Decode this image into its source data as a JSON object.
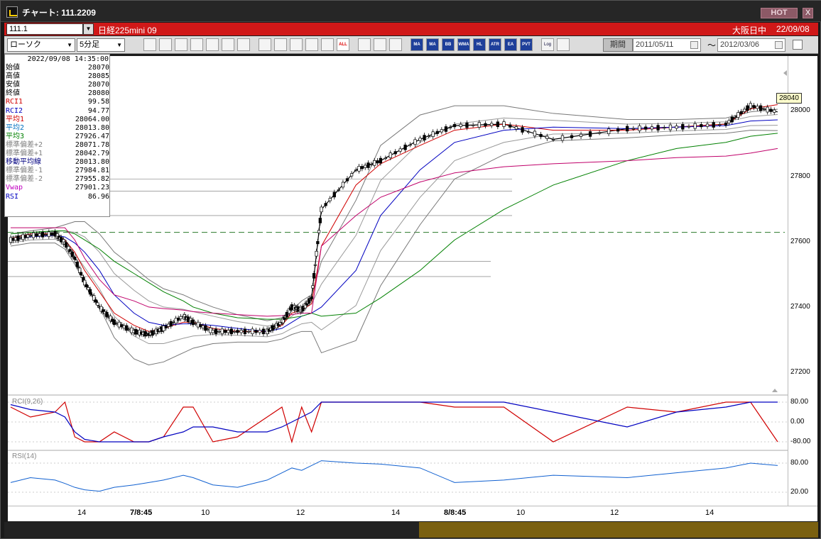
{
  "window": {
    "title": "チャート: 111.2209",
    "hot": "HOT",
    "close": "X"
  },
  "header": {
    "symbol": "111.1",
    "instrument": "日経225mini 09",
    "market": "大阪日中",
    "date": "22/09/08"
  },
  "toolbar": {
    "chart_type": "ローソク",
    "timeframe": "5分足",
    "buttons": [
      "zoom",
      "crosshair",
      "step-down",
      "zoom-chart",
      "icon",
      "icon",
      "icon",
      "pen",
      "cursor",
      "refresh",
      "candle-a",
      "candle-b",
      "ALL",
      "settings",
      "pencil",
      "color",
      "MA",
      "MA",
      "BB",
      "WMA",
      "HL",
      "ATR",
      "EA",
      "PVT",
      "Log",
      "export"
    ],
    "period_label": "期間",
    "date_from": "2011/05/11",
    "tilde": "～",
    "date_to": "2012/03/06"
  },
  "info_panel": {
    "datetime": "2022/09/08  14:35:00",
    "rows": [
      {
        "label": "始値",
        "value": "28070",
        "color": "#000000"
      },
      {
        "label": "高値",
        "value": "28085",
        "color": "#000000"
      },
      {
        "label": "安値",
        "value": "28070",
        "color": "#000000"
      },
      {
        "label": "終値",
        "value": "28080",
        "color": "#000000"
      },
      {
        "label": "RCI1",
        "value": "99.58",
        "color": "#d00000"
      },
      {
        "label": "RCI2",
        "value": "94.77",
        "color": "#0000c0"
      },
      {
        "label": "平均1",
        "value": "28064.00",
        "color": "#d00000"
      },
      {
        "label": "平均2",
        "value": "28013.80",
        "color": "#0070c0"
      },
      {
        "label": "平均3",
        "value": "27926.47",
        "color": "#008000"
      },
      {
        "label": "標準偏差+2",
        "value": "28071.78",
        "color": "#808080"
      },
      {
        "label": "標準偏差+1",
        "value": "28042.79",
        "color": "#808080"
      },
      {
        "label": "移動平均線",
        "value": "28013.80",
        "color": "#000080"
      },
      {
        "label": "標準偏差-1",
        "value": "27984.81",
        "color": "#808080"
      },
      {
        "label": "標準偏差-2",
        "value": "27955.82",
        "color": "#808080"
      },
      {
        "label": "Vwap",
        "value": "27901.23",
        "color": "#c000c0"
      },
      {
        "label": "RSI",
        "value": "86.96",
        "color": "#0000c0"
      }
    ]
  },
  "last_price": "28040",
  "subpanels": {
    "rci_label": "RCI(9,26)",
    "rsi_label": "RSI(14)"
  },
  "chart_data": {
    "type": "line",
    "title": "",
    "y_ticks_main": [
      "28000",
      "27800",
      "27600",
      "27400",
      "27200"
    ],
    "y_ticks_rci": [
      "80.00",
      "0.00",
      "-80.00"
    ],
    "y_ticks_rsi": [
      "80.00",
      "20.00"
    ],
    "x_ticks": [
      "14",
      "7/8:45",
      "10",
      "12",
      "14",
      "8/8:45",
      "10",
      "12",
      "14"
    ],
    "ylim": [
      27130,
      28200
    ],
    "x": [
      0,
      8,
      18,
      22,
      26,
      30,
      36,
      42,
      50,
      56,
      62,
      70,
      74,
      82,
      92,
      104,
      110,
      114,
      118,
      122,
      126,
      140,
      150,
      166,
      180,
      200,
      220,
      250,
      270,
      290,
      300,
      311
    ],
    "series": [
      {
        "name": "",
        "values": [
          27620,
          27635,
          27640,
          27610,
          27560,
          27480,
          27400,
          27350,
          27320,
          27310,
          27330,
          27370,
          27350,
          27320,
          27320,
          27320,
          27350,
          27400,
          27390,
          27430,
          27720,
          27850,
          27880,
          27950,
          27995,
          28000,
          27950,
          27985,
          27990,
          28000,
          28060,
          28040
        ],
        "color": "#000000"
      },
      {
        "name": "",
        "values": [
          27625,
          27640,
          27640,
          27620,
          27580,
          27520,
          27450,
          27380,
          27340,
          27320,
          27330,
          27350,
          27350,
          27330,
          27320,
          27320,
          27340,
          27380,
          27390,
          27410,
          27600,
          27800,
          27870,
          27930,
          27980,
          28000,
          27980,
          27980,
          27990,
          28000,
          28050,
          28064
        ],
        "color": "#d00000"
      },
      {
        "name": "",
        "values": [
          27620,
          27630,
          27635,
          27630,
          27610,
          27580,
          27520,
          27440,
          27380,
          27350,
          27340,
          27345,
          27345,
          27340,
          27330,
          27320,
          27330,
          27350,
          27370,
          27380,
          27400,
          27520,
          27700,
          27850,
          27940,
          27980,
          27990,
          27985,
          27990,
          27995,
          28010,
          28013.8
        ],
        "color": "#0000c0"
      },
      {
        "name": "",
        "values": [
          27640,
          27645,
          27650,
          27650,
          27640,
          27620,
          27590,
          27550,
          27510,
          27480,
          27450,
          27420,
          27400,
          27380,
          27365,
          27360,
          27360,
          27365,
          27370,
          27380,
          27370,
          27380,
          27430,
          27520,
          27620,
          27720,
          27800,
          27880,
          27920,
          27940,
          27960,
          27970
        ],
        "color": "#008000"
      },
      {
        "name": "",
        "values": [
          27660,
          27660,
          27660,
          27660,
          27620,
          27560,
          27490,
          27440,
          27420,
          27400,
          27395,
          27390,
          27385,
          27380,
          27375,
          27370,
          27372,
          27375,
          27380,
          27380,
          27600,
          27700,
          27760,
          27810,
          27840,
          27860,
          27870,
          27880,
          27890,
          27895,
          27905,
          27920
        ],
        "color": "#c0006a"
      }
    ],
    "dashed_level": 27645
  }
}
